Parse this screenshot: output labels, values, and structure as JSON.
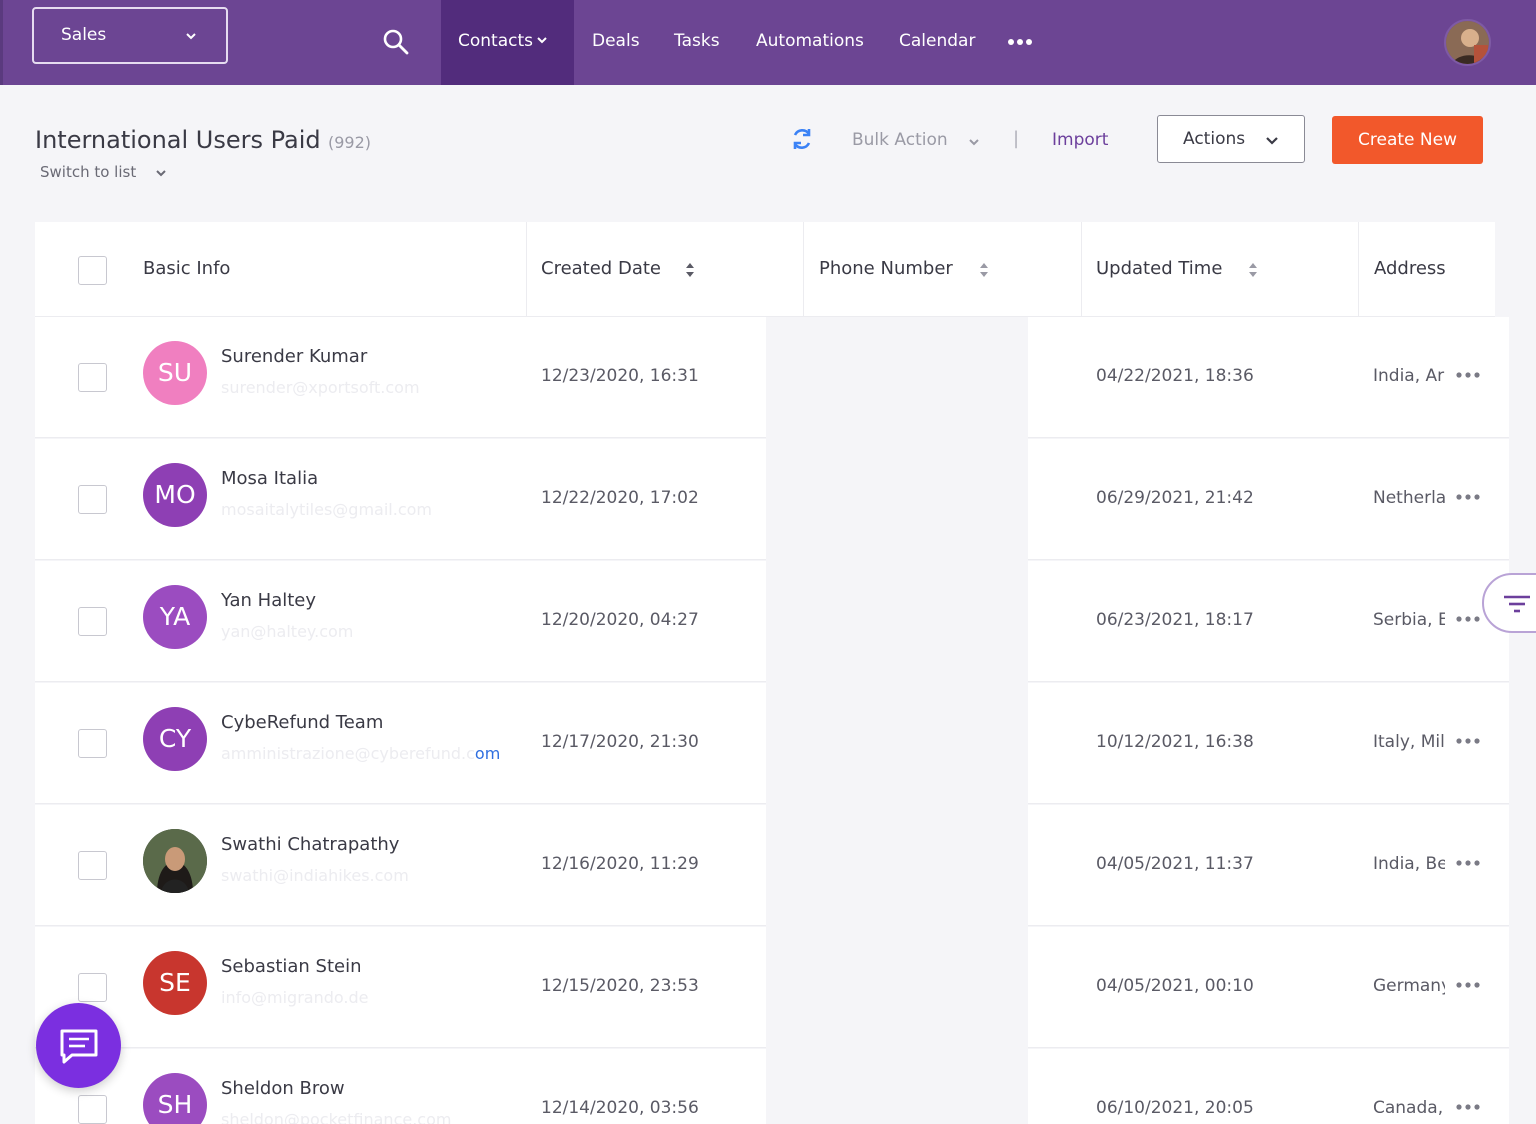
{
  "nav": {
    "pipeline": "Sales",
    "items": [
      "Contacts",
      "Deals",
      "Tasks",
      "Automations",
      "Calendar"
    ]
  },
  "header": {
    "title": "International Users Paid",
    "count": "(992)",
    "switch_list": "Switch to list",
    "bulk_action": "Bulk Action",
    "separator": "|",
    "import": "Import",
    "actions": "Actions",
    "create_new": "Create New"
  },
  "table": {
    "columns": [
      "Basic Info",
      "Created Date",
      "Phone Number",
      "Updated Time",
      "Address"
    ],
    "rows": [
      {
        "initials": "SU",
        "name": "Surender Kumar",
        "email": "surender@xportsoft.com",
        "email_link": "",
        "created": "12/23/2020, 16:31",
        "updated": "04/22/2021, 18:36",
        "address": "India, Ar",
        "avatar_color": "#f07fc0"
      },
      {
        "initials": "MO",
        "name": "Mosa Italia",
        "email": "mosaitalytiles@gmail.com",
        "email_link": "",
        "created": "12/22/2020, 17:02",
        "updated": "06/29/2021, 21:42",
        "address": "Netherla",
        "avatar_color": "#8e3fb4"
      },
      {
        "initials": "YA",
        "name": "Yan Haltey",
        "email": "yan@haltey.com",
        "email_link": "",
        "created": "12/20/2020, 04:27",
        "updated": "06/23/2021, 18:17",
        "address": "Serbia, E",
        "avatar_color": "#9b4cc0"
      },
      {
        "initials": "CY",
        "name": "CybeRefund Team",
        "email": "amministrazione@cyberefund.c",
        "email_link": "om",
        "created": "12/17/2020, 21:30",
        "updated": "10/12/2021, 16:38",
        "address": "Italy, Mil",
        "avatar_color": "#8e3fb4"
      },
      {
        "initials": "",
        "name": "Swathi Chatrapathy",
        "email": "swathi@indiahikes.com",
        "email_link": "",
        "created": "12/16/2020, 11:29",
        "updated": "04/05/2021, 11:37",
        "address": "India, Be",
        "avatar_color": "#3a4a3a"
      },
      {
        "initials": "SE",
        "name": "Sebastian Stein",
        "email": "info@migrando.de",
        "email_link": "",
        "created": "12/15/2020, 23:53",
        "updated": "04/05/2021, 00:10",
        "address": "Germany",
        "avatar_color": "#c8362e"
      },
      {
        "initials": "SH",
        "name": "Sheldon Brow",
        "email": "sheldon@pocketfinance.com",
        "email_link": "",
        "created": "12/14/2020, 03:56",
        "updated": "06/10/2021, 20:05",
        "address": "Canada,",
        "avatar_color": "#9b4cc0"
      }
    ]
  },
  "colors": {
    "nav_bg": "#6c4593",
    "nav_active": "#522c7c",
    "primary_button": "#f2582b",
    "link": "#6c3f9c",
    "chat_fab": "#7b2fe0"
  }
}
